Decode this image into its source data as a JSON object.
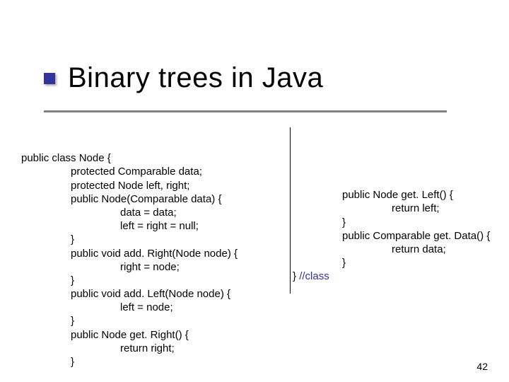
{
  "title": "Binary trees in Java",
  "page_number": "42",
  "code_left": {
    "l01": "public class Node {",
    "l02": "protected Comparable data;",
    "l03": "protected Node left, right;",
    "l04": "public Node(Comparable data) {",
    "l05": "data = data;",
    "l06": "left = right = null;",
    "l07": "}",
    "l08": "public void add. Right(Node node) {",
    "l09": "right = node;",
    "l10": "}",
    "l11": "public void add. Left(Node node) {",
    "l12": "left = node;",
    "l13": "}",
    "l14": "public Node get. Right() {",
    "l15": "return right;",
    "l16": "}"
  },
  "code_right": {
    "r01": "public Node get. Left() {",
    "r02": "return left;",
    "r03": "}",
    "r04": "public Comparable get. Data() {",
    "r05": "return data;",
    "r06": "}",
    "r07a": "} ",
    "r07b": "//class"
  }
}
